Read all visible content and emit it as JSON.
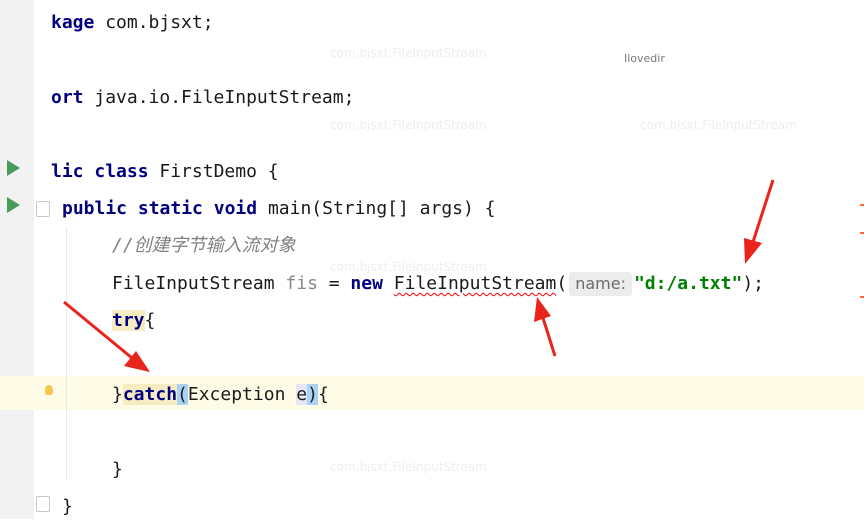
{
  "editor": {
    "watermark": "Ilovedir",
    "lines": {
      "l1_kw": "kage",
      "l1_rest": " com.bjsxt;",
      "l2_kw": "ort",
      "l2_rest": " java.io.FileInputStream;",
      "l3_kw1": "lic",
      "l3_kw2": "class",
      "l3_rest": " FirstDemo {",
      "l4_kw1": "public",
      "l4_kw2": "static",
      "l4_kw3": "void",
      "l4_rest": " main(String[] args) {",
      "l5_comment": "//创建字节输入流对象",
      "l6_type": "FileInputStream ",
      "l6_var": "fis",
      "l6_eq": " = ",
      "l6_new": "new",
      "l6_space": " ",
      "l6_ctor": "FileInputStream",
      "l6_paren": "(",
      "l6_hint": "name:",
      "l6_str": "\"d:/a.txt\"",
      "l6_end": ");",
      "l7_try": "try",
      "l7_brace": "{",
      "l9_close": "}",
      "l9_catch": "catch",
      "l9_paren": "(",
      "l9_type": "Exception ",
      "l9_param": "e",
      "l9_rparen": ")",
      "l9_brace": "{",
      "l11_close": "}",
      "l12_close": "}"
    },
    "ghost_text": "com.bjsxt.FileInputStream"
  },
  "colors": {
    "keyword": "#000080",
    "string": "#008000",
    "comment": "#808080",
    "annotation_arrow": "#e8241c"
  },
  "icons": {
    "run": "run-gutter-icon",
    "bulb": "intention-bulb-icon"
  }
}
